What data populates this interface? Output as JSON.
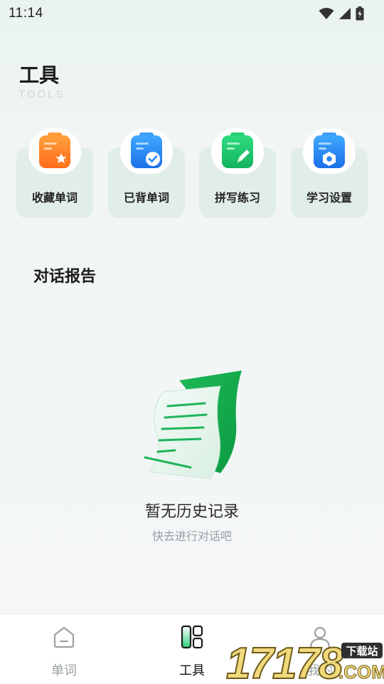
{
  "status_bar": {
    "time": "11:14"
  },
  "header": {
    "title": "工具",
    "subtitle": "TOOLS"
  },
  "tools": [
    {
      "label": "收藏单词",
      "icon": "favorite-words-icon",
      "color": "#ff8a2b"
    },
    {
      "label": "已背单词",
      "icon": "learned-words-icon",
      "color": "#2f8ff5"
    },
    {
      "label": "拼写练习",
      "icon": "spelling-practice-icon",
      "color": "#20c46a"
    },
    {
      "label": "学习设置",
      "icon": "study-settings-icon",
      "color": "#2f8ff5"
    }
  ],
  "report": {
    "title": "对话报告",
    "empty_title": "暂无历史记录",
    "empty_subtitle": "快去进行对话吧"
  },
  "bottom_nav": {
    "items": [
      {
        "label": "单词",
        "icon": "home-icon",
        "active": false
      },
      {
        "label": "工具",
        "icon": "tools-icon",
        "active": true
      },
      {
        "label": "我的",
        "icon": "profile-icon",
        "active": false
      }
    ]
  },
  "watermark": {
    "text": "17178",
    "badge": "下载站",
    "suffix": ".COM"
  },
  "colors": {
    "accent_green": "#1fbf62",
    "card_bg": "#e0ede8",
    "nav_inactive": "#9aa0a3"
  }
}
